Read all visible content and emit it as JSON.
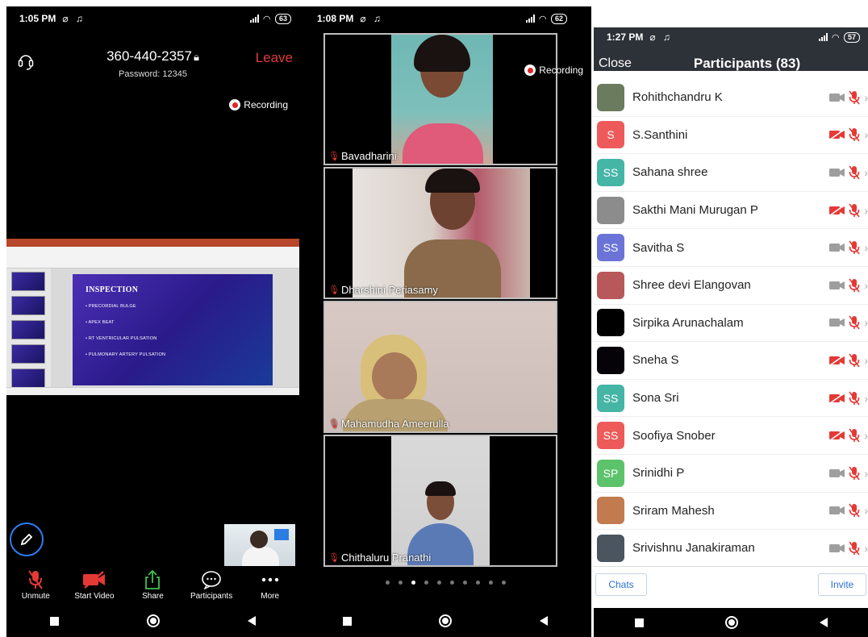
{
  "phone1": {
    "status": {
      "time": "1:05 PM",
      "icons": "⌀ ♫",
      "battery": "63"
    },
    "meeting_id": "360-440-2357",
    "password": "Password: 12345",
    "leave_label": "Leave",
    "recording_label": "Recording",
    "slide": {
      "title": "INSPECTION",
      "bullets": [
        "• PRECORDIAL BULGE",
        "• APEX BEAT",
        "• RT VENTRICULAR PULSATION",
        "• PULMONARY ARTERY PULSATION"
      ]
    },
    "toolbar": [
      {
        "label": "Unmute",
        "icon": "mic-muted-icon"
      },
      {
        "label": "Start Video",
        "icon": "video-off-icon"
      },
      {
        "label": "Share",
        "icon": "share-icon"
      },
      {
        "label": "Participants",
        "icon": "participants-icon"
      },
      {
        "label": "More",
        "icon": "more-icon"
      }
    ]
  },
  "phone2": {
    "status": {
      "time": "1:08 PM",
      "icons": "⌀ ♫",
      "battery": "62"
    },
    "recording_label": "Recording",
    "tiles": [
      {
        "name": "Bavadharini"
      },
      {
        "name": "Dharshini Periasamy"
      },
      {
        "name": "Mahamudha Ameerulla"
      },
      {
        "name": "Chithaluru Pranathi"
      }
    ],
    "page_count": 10,
    "active_page": 3
  },
  "phone3": {
    "status": {
      "time": "1:27 PM",
      "icons": "⌀ ♫",
      "battery": "57"
    },
    "close_label": "Close",
    "title": "Participants (83)",
    "participants": [
      {
        "name": "Rohithchandru K",
        "initials": "",
        "avatar_color": "#6b7b5e",
        "video_off_red": false
      },
      {
        "name": "S.Santhini",
        "initials": "S",
        "avatar_color": "#ee5a5a",
        "video_off_red": true
      },
      {
        "name": "Sahana shree",
        "initials": "SS",
        "avatar_color": "#45b5a6",
        "video_off_red": false
      },
      {
        "name": "Sakthi Mani Murugan P",
        "initials": "",
        "avatar_color": "#8c8c8c",
        "video_off_red": true
      },
      {
        "name": "Savitha S",
        "initials": "SS",
        "avatar_color": "#6b74d6",
        "video_off_red": false
      },
      {
        "name": "Shree devi Elangovan",
        "initials": "",
        "avatar_color": "#b8585a",
        "video_off_red": false
      },
      {
        "name": "Sirpika Arunachalam",
        "initials": "",
        "avatar_color": "#000000",
        "video_off_red": false
      },
      {
        "name": "Sneha S",
        "initials": "",
        "avatar_color": "#050208",
        "video_off_red": true
      },
      {
        "name": "Sona Sri",
        "initials": "SS",
        "avatar_color": "#45b5a6",
        "video_off_red": true
      },
      {
        "name": "Soofiya Snober",
        "initials": "SS",
        "avatar_color": "#ee5a5a",
        "video_off_red": true
      },
      {
        "name": "Srinidhi P",
        "initials": "SP",
        "avatar_color": "#5cc36b",
        "video_off_red": false
      },
      {
        "name": "Sriram Mahesh",
        "initials": "",
        "avatar_color": "#c27b4e",
        "video_off_red": false
      },
      {
        "name": "Srivishnu Janakiraman",
        "initials": "",
        "avatar_color": "#4a5560",
        "video_off_red": false
      }
    ],
    "chats_label": "Chats",
    "invite_label": "Invite"
  }
}
